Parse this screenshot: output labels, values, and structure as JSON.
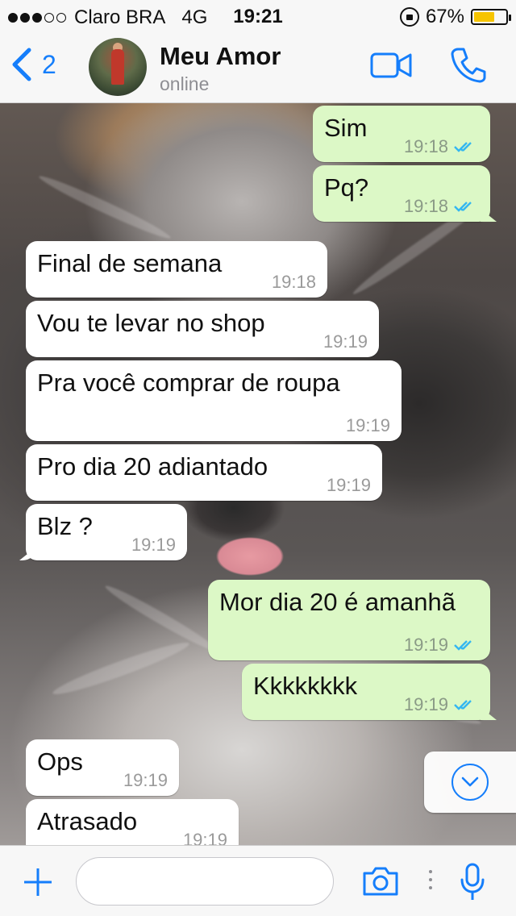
{
  "status_bar": {
    "carrier": "Claro BRA",
    "network": "4G",
    "time": "19:21",
    "battery_percent": "67%",
    "battery_level": 0.67,
    "signal_bars_on": 3,
    "signal_bars_total": 5
  },
  "header": {
    "back_count": "2",
    "contact_name": "Meu Amor",
    "contact_status": "online",
    "icons": [
      "back-chevron-icon",
      "video-call-icon",
      "phone-call-icon"
    ]
  },
  "colors": {
    "accent": "#157efb",
    "outgoing_bubble": "#dcf8c6",
    "incoming_bubble": "#ffffff",
    "read_ticks": "#34b7f1",
    "battery": "#f6c400"
  },
  "messages": [
    {
      "direction": "out",
      "text": "Sim",
      "time": "19:18",
      "status": "read"
    },
    {
      "direction": "out",
      "text": "Pq?",
      "time": "19:18",
      "status": "read"
    },
    {
      "direction": "in",
      "text": "Final de semana",
      "time": "19:18"
    },
    {
      "direction": "in",
      "text": "Vou te levar no shop",
      "time": "19:19"
    },
    {
      "direction": "in",
      "text": "Pra você comprar de roupa",
      "time": "19:19"
    },
    {
      "direction": "in",
      "text": "Pro dia 20 adiantado",
      "time": "19:19"
    },
    {
      "direction": "in",
      "text": "Blz ?",
      "time": "19:19"
    },
    {
      "direction": "out",
      "text": "Mor dia 20 é amanhã",
      "time": "19:19",
      "status": "read"
    },
    {
      "direction": "out",
      "text": "Kkkkkkkk",
      "time": "19:19",
      "status": "read"
    },
    {
      "direction": "in",
      "text": "Ops",
      "time": "19:19"
    },
    {
      "direction": "in",
      "text": "Atrasado",
      "time": "19:19"
    }
  ],
  "composer": {
    "value": "",
    "placeholder": "",
    "icons": [
      "plus-icon",
      "camera-icon",
      "microphone-icon"
    ]
  }
}
